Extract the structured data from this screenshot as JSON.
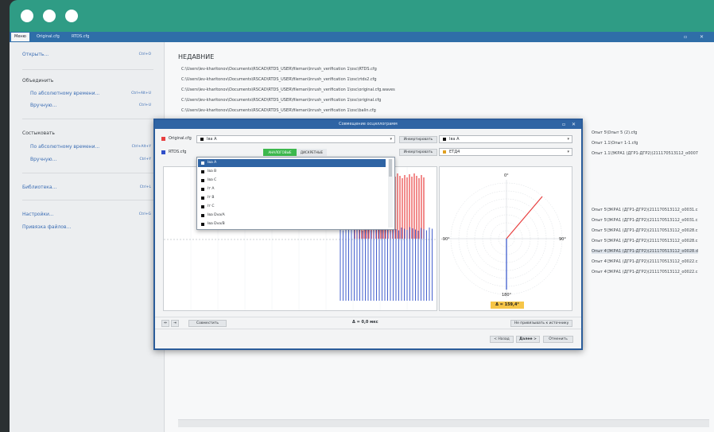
{
  "tabs": [
    "Меню",
    "Original.cfg",
    "RTDS.cfg"
  ],
  "sidebar": {
    "items": [
      {
        "label": "Открыть...",
        "key": "Ctrl+O",
        "head": false
      },
      {
        "label": "Объединить",
        "key": "",
        "head": true
      },
      {
        "label": "По абсолютному времени...",
        "key": "Ctrl+Alt+U",
        "head": false
      },
      {
        "label": "Вручную...",
        "key": "Ctrl+U",
        "head": false
      },
      {
        "label": "Состыковать",
        "key": "",
        "head": true
      },
      {
        "label": "По абсолютному времени...",
        "key": "Ctrl+Alt+Y",
        "head": false
      },
      {
        "label": "Вручную...",
        "key": "Ctrl+Y",
        "head": false
      },
      {
        "label": "Библиотека...",
        "key": "Ctrl+L",
        "head": false
      },
      {
        "label": "Настройки...",
        "key": "Ctrl+G",
        "head": false
      },
      {
        "label": "Привязка файлов...",
        "key": "",
        "head": false
      }
    ]
  },
  "main": {
    "recent_title": "НЕДАВНИЕ",
    "recent": [
      "C:\\Users\\lev-kharitonov\\Documents\\RSCAD\\RTDS_USER\\fileman\\Inrush_verification 1\\osc\\RTDS.cfg",
      "C:\\Users\\lev-kharitonov\\Documents\\RSCAD\\RTDS_USER\\fileman\\Inrush_verification 1\\osc\\rtds2.cfg",
      "C:\\Users\\lev-kharitonov\\Documents\\RSCAD\\RTDS_USER\\fileman\\Inrush_verification 1\\osc\\original.cfg.waves",
      "C:\\Users\\lev-kharitonov\\Documents\\RSCAD\\RTDS_USER\\fileman\\Inrush_verification 1\\osc\\original.cfg",
      "C:\\Users\\lev-kharitonov\\Documents\\RSCAD\\RTDS_USER\\fileman\\Inrush_verification 1\\osc\\balin.cfg"
    ],
    "right_files": [
      "Опыт 5\\Опыт 5 (2).cfg",
      "Опыт 1.1\\Опыт 1-1.cfg",
      "Опыт 1.1\\ЭКРА1 (ДГР1-ДГР2)(211170513112_о0007",
      "Опыт 5\\ЭКРА1 (ДГР1-ДГР2)(211170513112_о0031.c",
      "Опыт 5\\ЭКРА1 (ДГР1-ДГР2)(211170513112_о0031.c",
      "Опыт 5\\ЭКРА1 (ДГР1-ДГР2)(211170513112_о0028.c",
      "Опыт 5\\ЭКРА1 (ДГР1-ДГР2)(211170513112_о0028.c",
      "Опыт 4\\ЭКРА1 (ДГР1-ДГР2)(211170513112_о0028.d",
      "Опыт 4\\ЭКРА1 (ДГР1-ДГР2)(211170513112_о0022.c",
      "Опыт 4\\ЭКРА1 (ДГР1-ДГР2)(211170513112_о0022.c"
    ]
  },
  "dialog": {
    "title": "Совмещение осциллограмм",
    "row1_file": "Original.cfg",
    "row2_file": "RTDS.cfg",
    "select1": "Iва A",
    "invert_label": "Инвертировать",
    "select_right1": "Iва A",
    "select_right2": "ЕТД4",
    "toggle_on": "АНАЛОГОВЫЕ",
    "toggle_off": "ДИСКРЕТНЫЕ",
    "dropdown": [
      "Iва A",
      "Iва B",
      "Iва C",
      "Iт A",
      "Iт B",
      "Iт C",
      "Iва Dva/A",
      "Iва Dva/B"
    ],
    "combine_button": "Совместить",
    "delta_time": "Δ = 0,0 мкс",
    "no_bind_button": "Не привязывать к источнику",
    "back_button": "< Назад",
    "next_button": "Далее >",
    "cancel_button": "Отменить",
    "polar_labels": {
      "top": "0°",
      "left": "-90°",
      "right": "90°",
      "bottom": "180°"
    },
    "angle_badge": "Δ = 159,4°",
    "colors": {
      "series1": "#e84040",
      "series2": "#2f4fc9",
      "accent": "#2f9c85"
    }
  }
}
